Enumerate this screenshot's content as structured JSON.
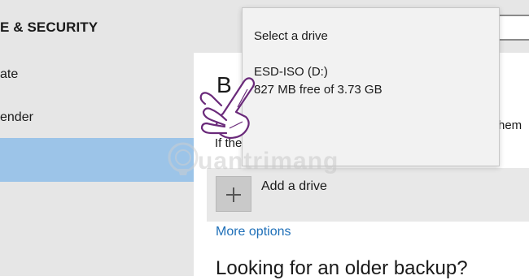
{
  "header": {
    "title": "E & SECURITY"
  },
  "sidebar": {
    "items": [
      {
        "label": "ate"
      },
      {
        "label": "ender"
      }
    ]
  },
  "main": {
    "heading": "B",
    "paragraph_start": "If the",
    "paragraph_end": "hem",
    "add_drive_label": "Add a drive",
    "more_options_label": "More options",
    "older_backup_heading": "Looking for an older backup?"
  },
  "flyout": {
    "title": "Select a drive",
    "drives": [
      {
        "name": "ESD-ISO (D:)",
        "free": "827 MB free of 3.73 GB"
      }
    ]
  },
  "watermark": {
    "text": "uantrimang"
  },
  "colors": {
    "accent_link": "#1e6fb8",
    "selected_nav": "#9cc4e8",
    "hand_outline": "#6a2a7a"
  },
  "icons": {
    "add_drive": "plus-icon",
    "pointer": "hand-pointer-icon",
    "watermark_bulb": "lightbulb-icon"
  }
}
